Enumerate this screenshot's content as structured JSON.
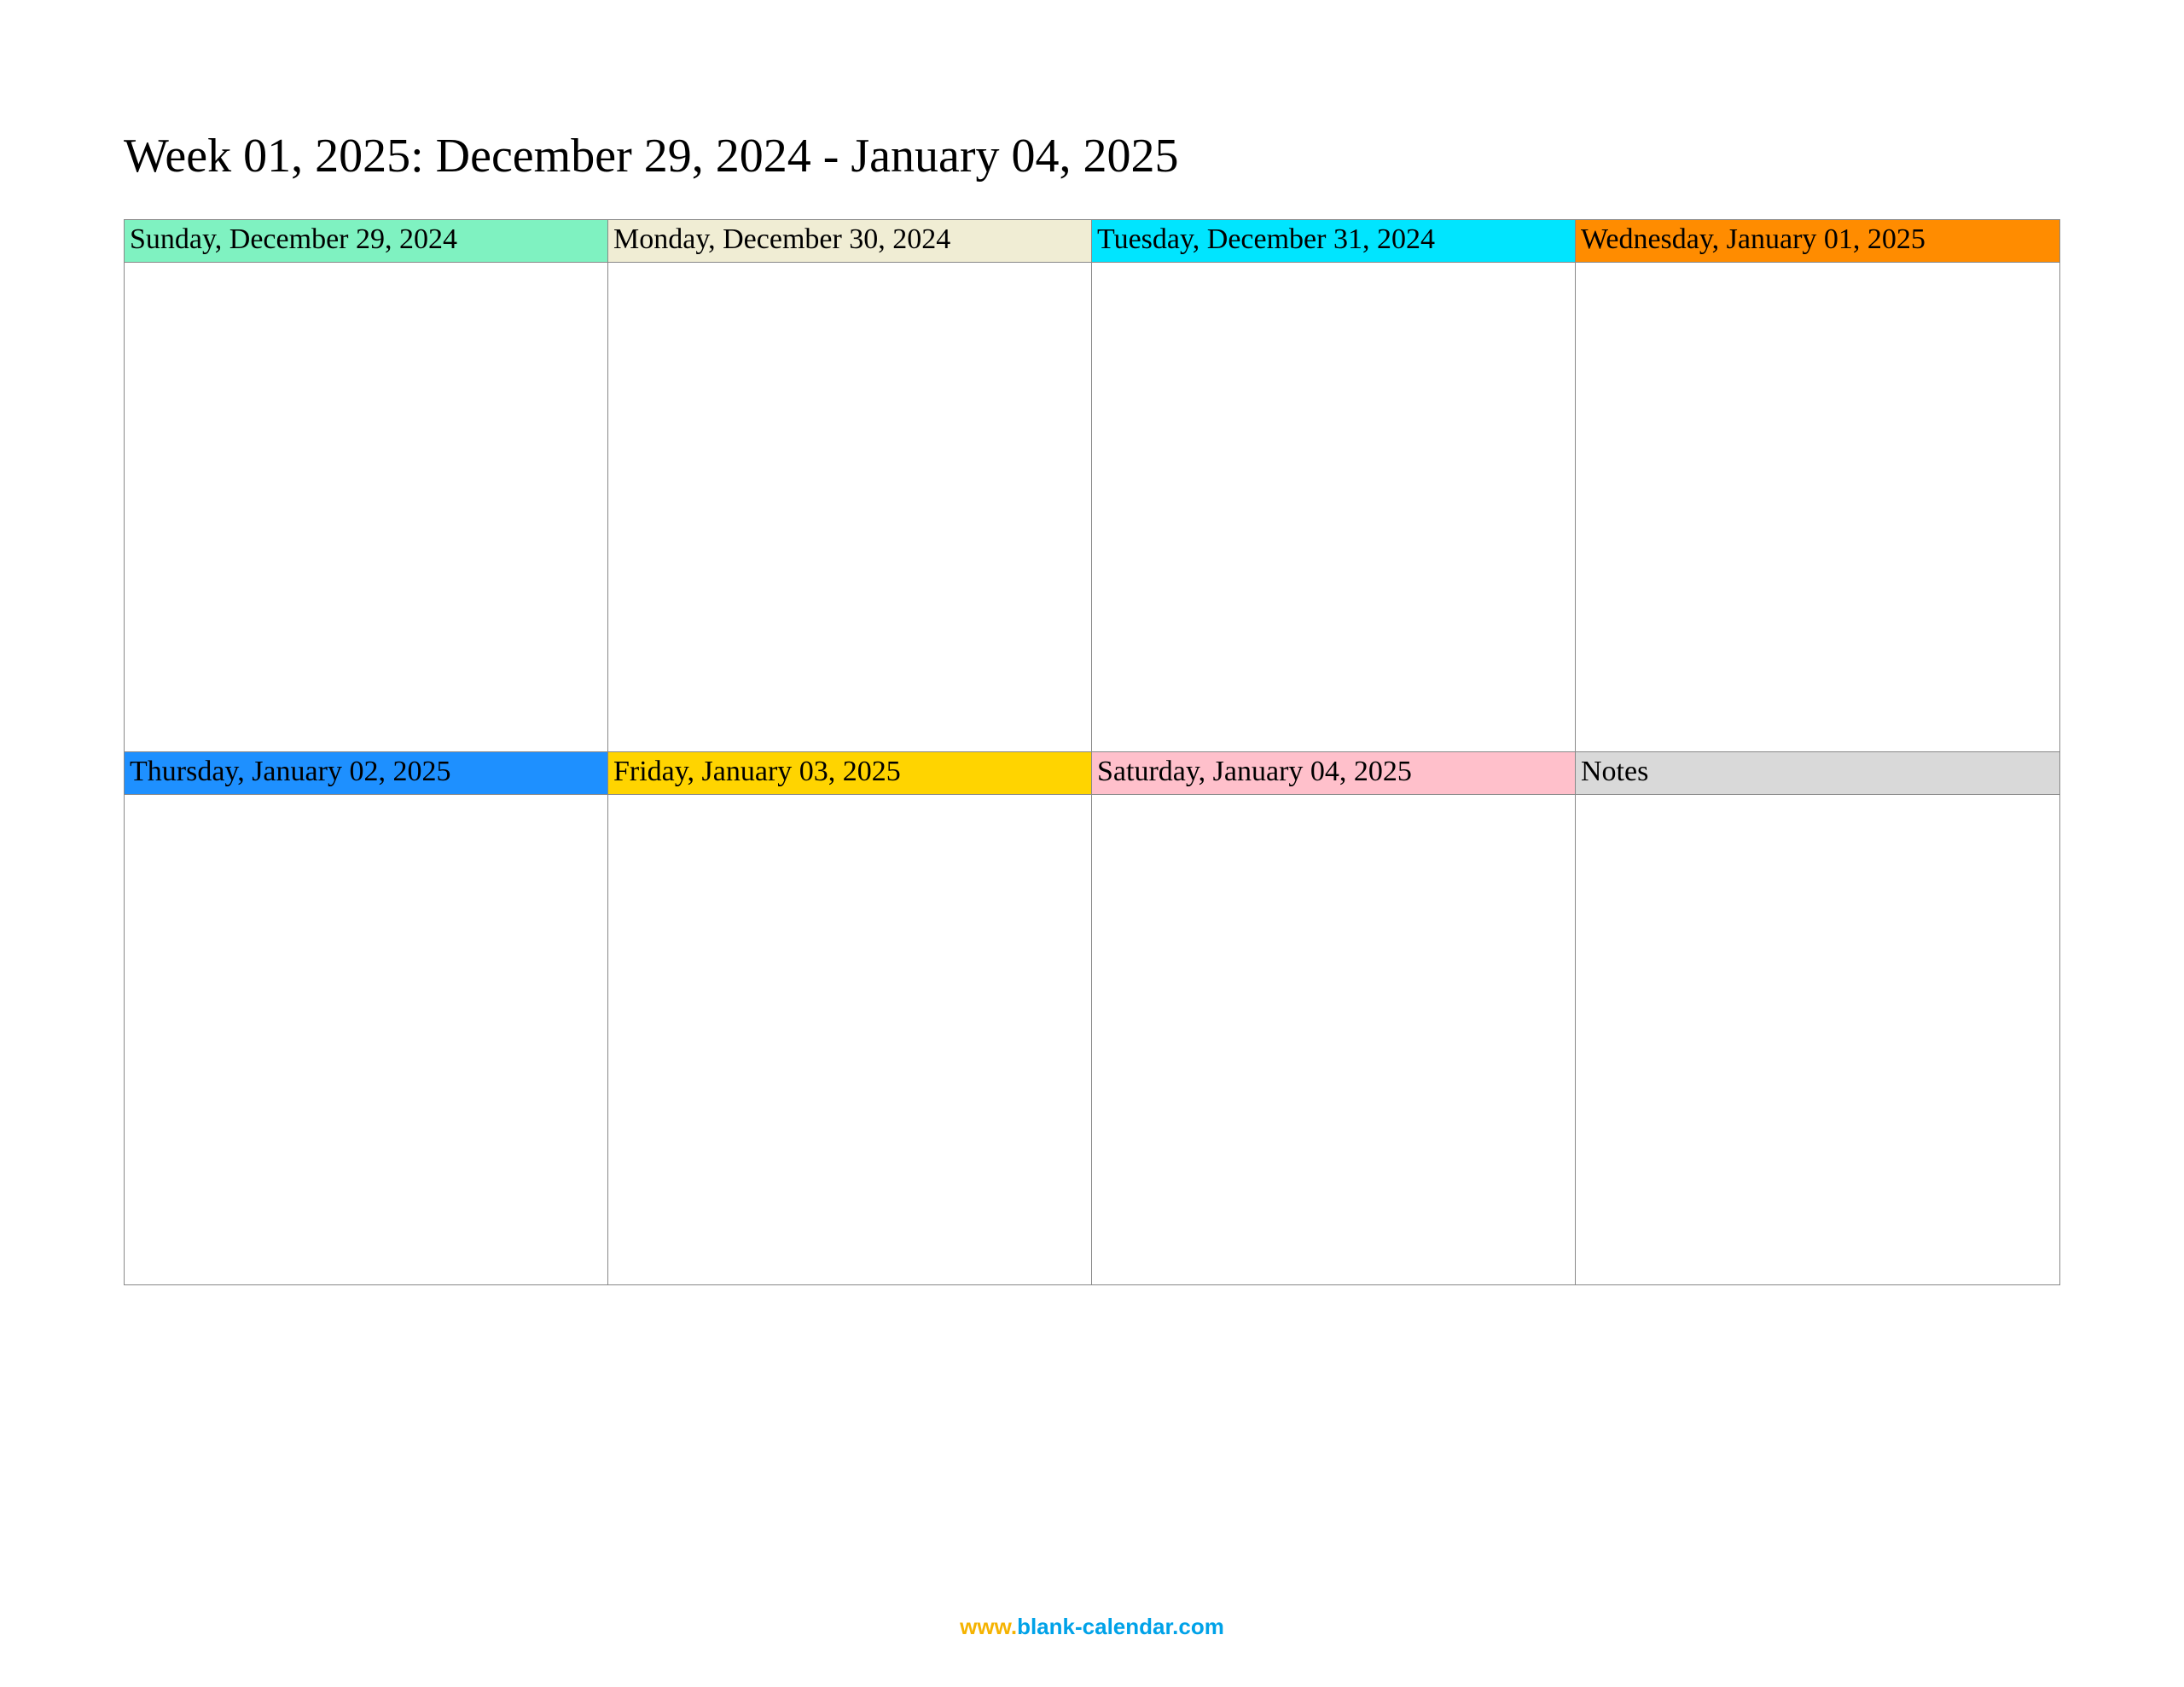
{
  "title": "Week 01, 2025: December 29, 2024 - January 04, 2025",
  "cells": {
    "sun": {
      "label": "Sunday, December 29, 2024"
    },
    "mon": {
      "label": "Monday, December 30, 2024"
    },
    "tue": {
      "label": "Tuesday, December 31, 2024"
    },
    "wed": {
      "label": "Wednesday, January 01, 2025"
    },
    "thu": {
      "label": "Thursday, January 02, 2025"
    },
    "fri": {
      "label": "Friday, January 03, 2025"
    },
    "sat": {
      "label": "Saturday, January 04, 2025"
    },
    "notes": {
      "label": "Notes"
    }
  },
  "footer": {
    "part1": "www.",
    "part2": "blank-calendar.com"
  },
  "colors": {
    "sun": "#7ff2c1",
    "mon": "#f0edd4",
    "tue": "#00e5ff",
    "wed": "#ff8c00",
    "thu": "#1e90ff",
    "fri": "#ffd400",
    "sat": "#ffc0cb",
    "notes": "#d9d9d9"
  }
}
